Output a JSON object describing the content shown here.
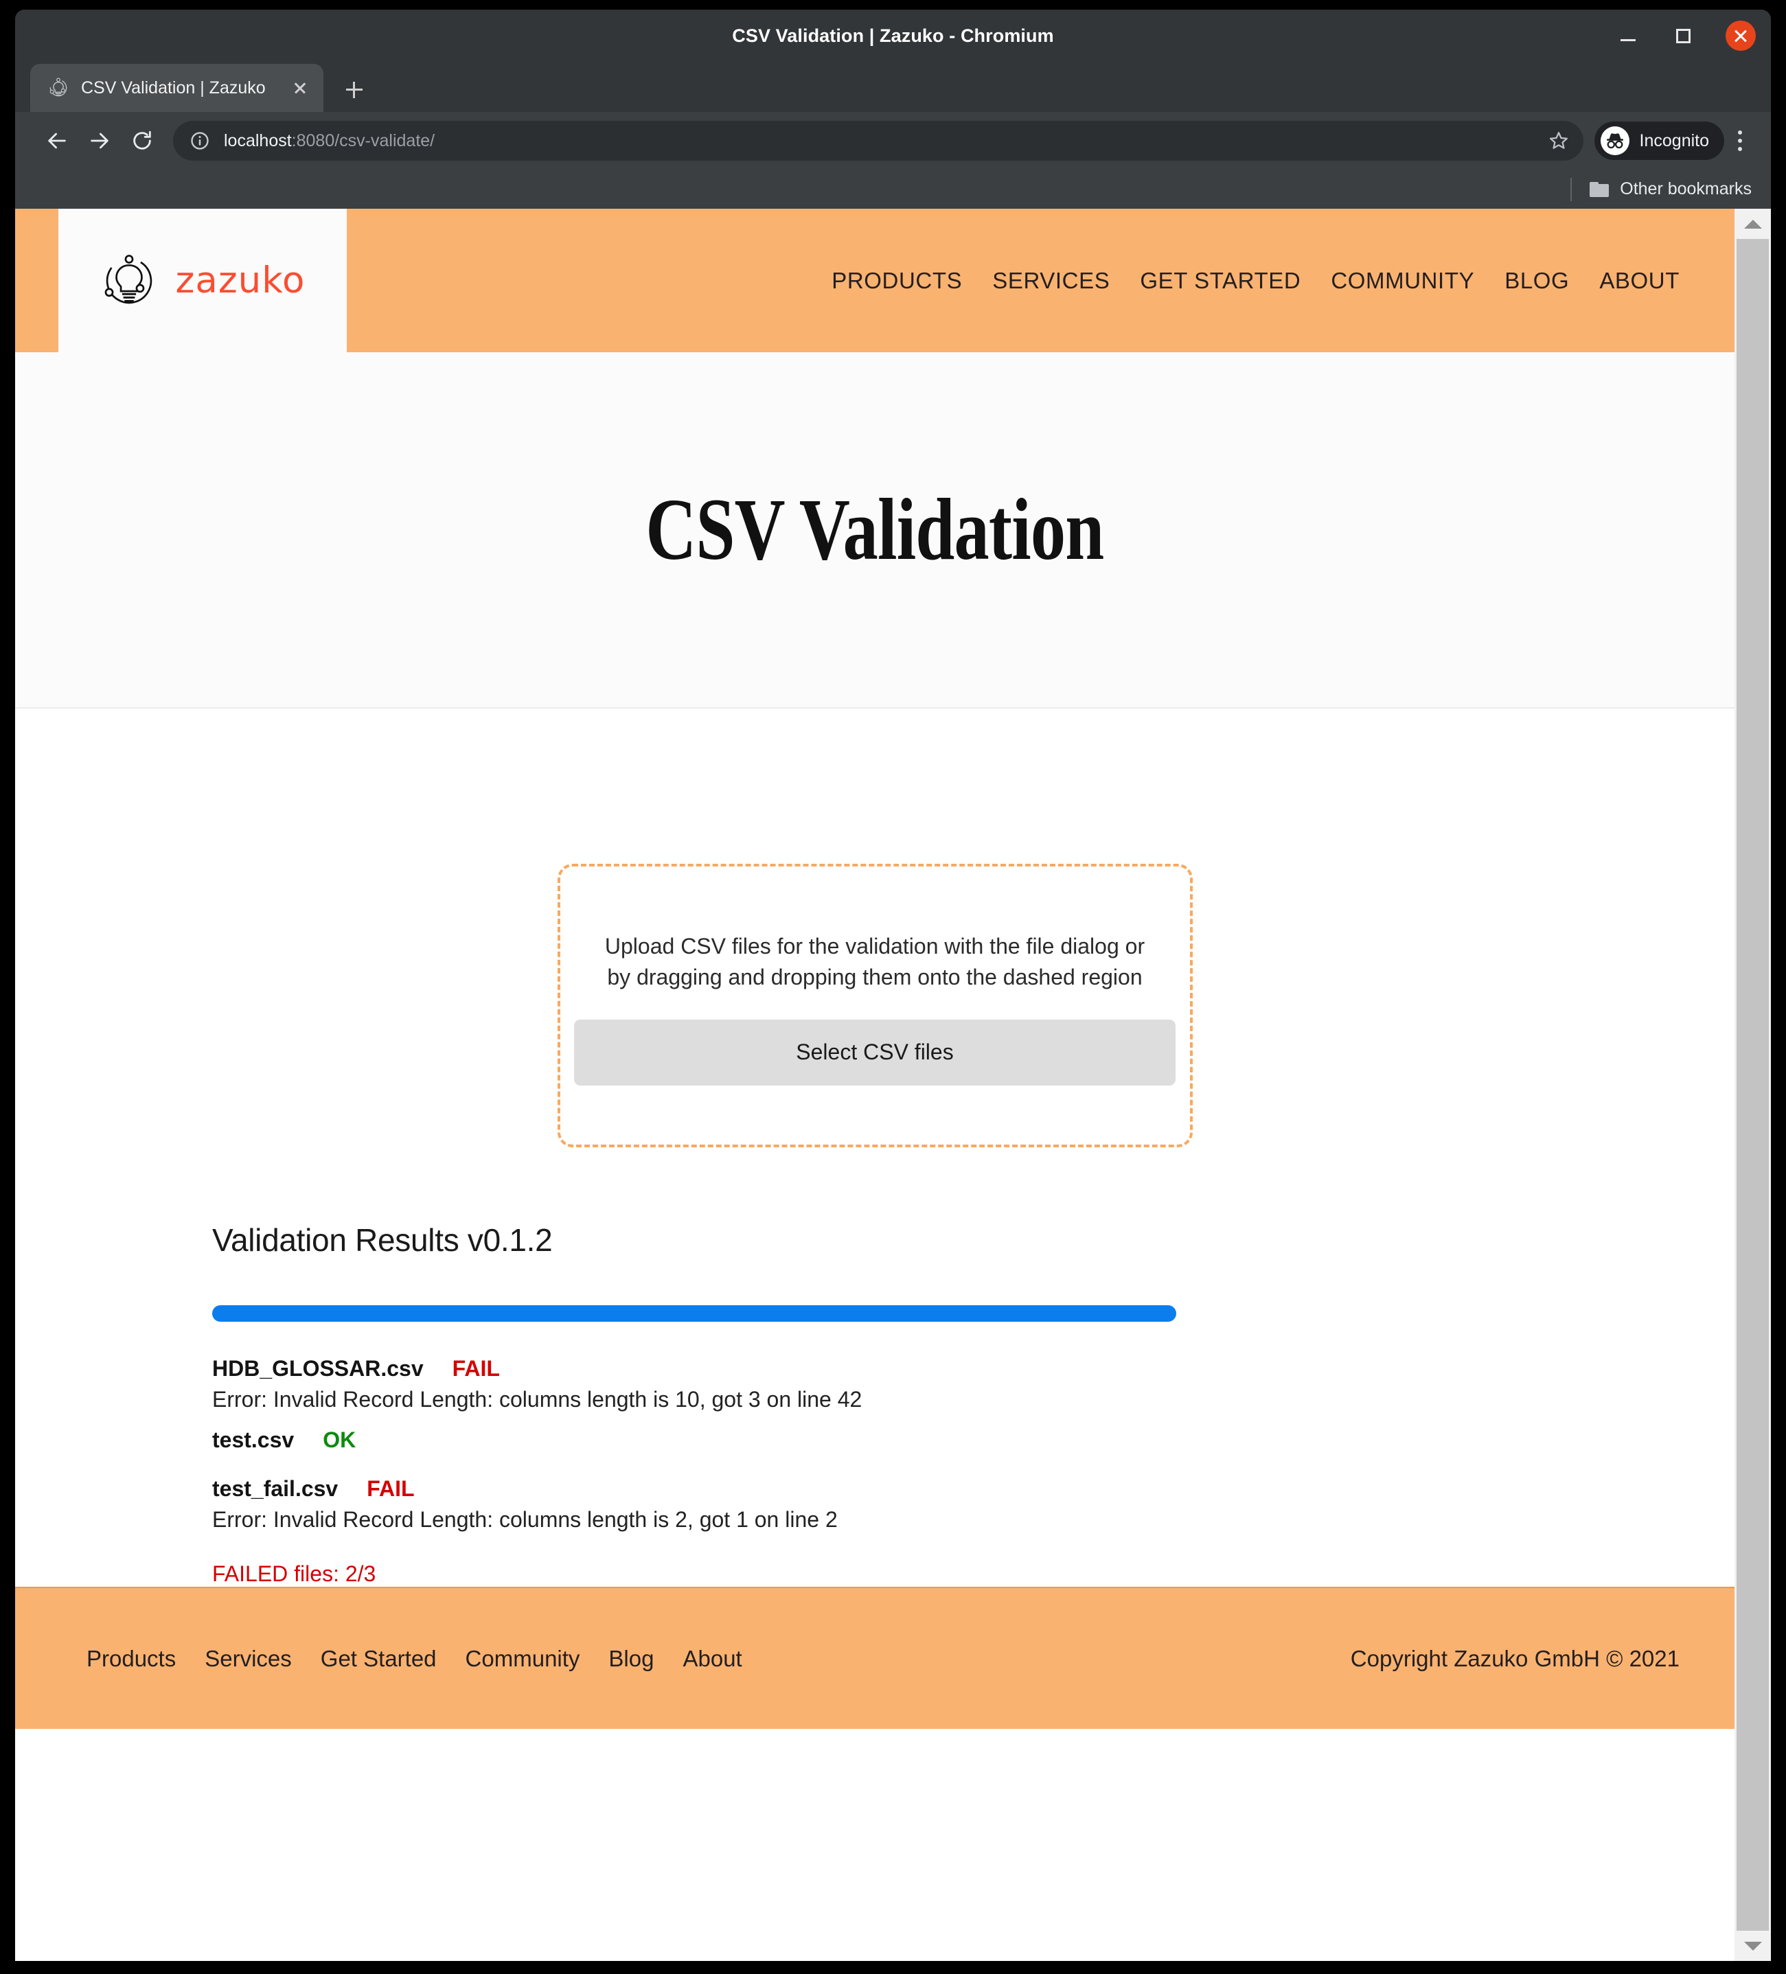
{
  "window": {
    "title": "CSV Validation | Zazuko - Chromium",
    "minimize_label": "Minimize",
    "maximize_label": "Maximize",
    "close_label": "Close"
  },
  "browser": {
    "tab": {
      "title": "CSV Validation | Zazuko",
      "favicon": "zazuko-bulb-icon",
      "close_label": "Close tab"
    },
    "new_tab_label": "New tab",
    "back_label": "Back",
    "forward_label": "Forward",
    "reload_label": "Reload",
    "omnibox": {
      "host": "localhost",
      "path": ":8080/csv-validate/",
      "full_url": "localhost:8080/csv-validate/",
      "info_icon": "site-info-icon",
      "bookmark_icon": "star-icon"
    },
    "profile": {
      "label": "Incognito",
      "icon": "incognito-icon"
    },
    "menu_label": "Customize and control Chromium",
    "bookmarks": {
      "other_bookmarks_label": "Other bookmarks",
      "folder_icon": "folder-icon"
    }
  },
  "site": {
    "logo": {
      "word": "zazuko",
      "mark": "zazuko-bulb-icon",
      "color": "#f94e32"
    },
    "nav": [
      {
        "label": "PRODUCTS"
      },
      {
        "label": "SERVICES"
      },
      {
        "label": "GET STARTED"
      },
      {
        "label": "COMMUNITY"
      },
      {
        "label": "BLOG"
      },
      {
        "label": "ABOUT"
      }
    ],
    "header_bg": "#fab270"
  },
  "hero": {
    "title": "CSV Validation"
  },
  "upload": {
    "instructions": "Upload CSV files for the validation with the file dialog or by dragging and dropping them onto the dashed region",
    "button_label": "Select CSV files",
    "dashed_border_color": "#f7a95f"
  },
  "results": {
    "heading": "Validation Results v0.1.2",
    "progress": {
      "percent": 100,
      "color": "#0b7ded"
    },
    "files": [
      {
        "name": "HDB_GLOSSAR.csv",
        "status": "FAIL",
        "status_kind": "fail",
        "error": "Error: Invalid Record Length: columns length is 10, got 3 on line 42"
      },
      {
        "name": "test.csv",
        "status": "OK",
        "status_kind": "ok",
        "error": ""
      },
      {
        "name": "test_fail.csv",
        "status": "FAIL",
        "status_kind": "fail",
        "error": "Error: Invalid Record Length: columns length is 2, got 1 on line 2"
      }
    ],
    "summary": "FAILED files: 2/3",
    "fail_color": "#d40000",
    "ok_color": "#0e8a0e"
  },
  "footer": {
    "links": [
      {
        "label": "Products"
      },
      {
        "label": "Services"
      },
      {
        "label": "Get Started"
      },
      {
        "label": "Community"
      },
      {
        "label": "Blog"
      },
      {
        "label": "About"
      }
    ],
    "copyright": "Copyright Zazuko GmbH © 2021"
  },
  "scrollbar": {
    "up_label": "Scroll up",
    "down_label": "Scroll down"
  }
}
